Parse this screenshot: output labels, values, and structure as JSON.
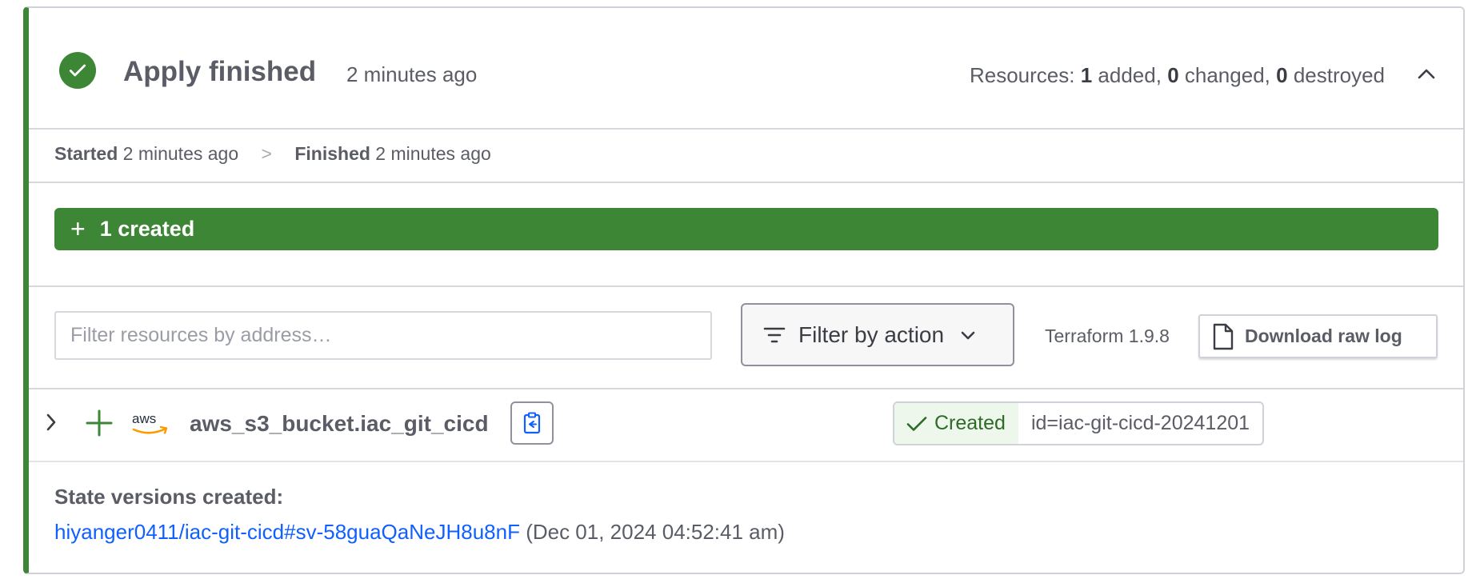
{
  "header": {
    "title": "Apply finished",
    "time": "2 minutes ago",
    "resources": {
      "prefix": "Resources:",
      "added_count": "1",
      "added_label": "added,",
      "changed_count": "0",
      "changed_label": "changed,",
      "destroyed_count": "0",
      "destroyed_label": "destroyed"
    }
  },
  "timeline": {
    "started_label": "Started",
    "started_time": "2 minutes ago",
    "separator": ">",
    "finished_label": "Finished",
    "finished_time": "2 minutes ago"
  },
  "summary": {
    "created_label": "1 created"
  },
  "toolbar": {
    "filter_placeholder": "Filter resources by address…",
    "filter_action_label": "Filter by action",
    "terraform_version": "Terraform 1.9.8",
    "download_label": "Download raw log"
  },
  "resource": {
    "provider_logo_text": "aws",
    "address": "aws_s3_bucket.iac_git_cicd",
    "status": "Created",
    "id": "id=iac-git-cicd-20241201"
  },
  "state_versions": {
    "label": "State versions created:",
    "link_text": "hiyanger0411/iac-git-cicd#sv-58guaQaNeJH8u8nF",
    "timestamp": "(Dec 01, 2024 04:52:41 am)"
  },
  "colors": {
    "success": "#3c8635",
    "link": "#1060ff"
  }
}
